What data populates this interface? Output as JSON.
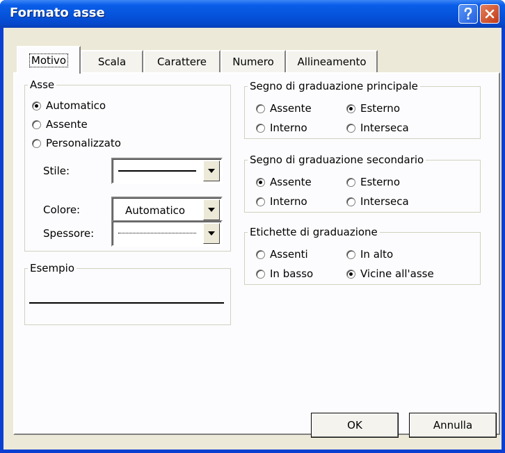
{
  "window": {
    "title": "Formato asse",
    "help_icon": "question-mark-icon",
    "close_icon": "close-icon"
  },
  "tabs": [
    {
      "label": "Motivo",
      "selected": true
    },
    {
      "label": "Scala",
      "selected": false
    },
    {
      "label": "Carattere",
      "selected": false
    },
    {
      "label": "Numero",
      "selected": false
    },
    {
      "label": "Allineamento",
      "selected": false
    }
  ],
  "asse": {
    "legend": "Asse",
    "options": [
      {
        "label": "Automatico",
        "checked": true
      },
      {
        "label": "Assente",
        "checked": false
      },
      {
        "label": "Personalizzato",
        "checked": false
      }
    ],
    "stile_label": "Stile:",
    "colore_label": "Colore:",
    "colore_value": "Automatico",
    "spessore_label": "Spessore:"
  },
  "esempio": {
    "legend": "Esempio"
  },
  "segno_principale": {
    "legend": "Segno di graduazione principale",
    "options": [
      {
        "label": "Assente",
        "checked": false
      },
      {
        "label": "Esterno",
        "checked": true
      },
      {
        "label": "Interno",
        "checked": false
      },
      {
        "label": "Interseca",
        "checked": false
      }
    ]
  },
  "segno_secondario": {
    "legend": "Segno di graduazione secondario",
    "options": [
      {
        "label": "Assente",
        "checked": true
      },
      {
        "label": "Esterno",
        "checked": false
      },
      {
        "label": "Interno",
        "checked": false
      },
      {
        "label": "Interseca",
        "checked": false
      }
    ]
  },
  "etichette": {
    "legend": "Etichette di graduazione",
    "options": [
      {
        "label": "Assenti",
        "checked": false
      },
      {
        "label": "In alto",
        "checked": false
      },
      {
        "label": "In basso",
        "checked": false
      },
      {
        "label": "Vicine all'asse",
        "checked": true
      }
    ]
  },
  "buttons": {
    "ok": "OK",
    "cancel": "Annulla"
  },
  "colors": {
    "title_bar": "#0653db",
    "dialog_face": "#ece9d8",
    "panel": "#fcfcfe",
    "close_button": "#c43a16"
  }
}
